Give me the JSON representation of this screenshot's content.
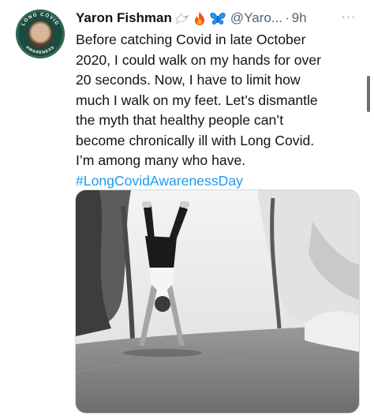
{
  "tweet": {
    "author_name": "Yaron Fishman",
    "author_emojis": [
      "dove-icon",
      "fire-icon",
      "butterfly-icon"
    ],
    "handle": "@Yaro...",
    "separator": "·",
    "time": "9h",
    "more": "···",
    "avatar": {
      "ring_top_text": "LONG COVID",
      "ring_bottom_text": "AWARENESS"
    },
    "text_lines": [
      "Before catching Covid in late October",
      "2020, I could walk on my hands for over",
      "20 seconds. Now, I have to limit how",
      "much I walk on my feet. Let’s dismantle",
      "the myth that healthy people can’t",
      "become chronically ill with Long Covid.",
      "I’m among many who have."
    ],
    "hashtag": "#LongCovidAwarenessDay",
    "media": {
      "kind": "photo",
      "subject": "person-handstand-icon"
    }
  },
  "colors": {
    "text": "#0f1419",
    "secondary": "#536471",
    "link": "#1d9bf0",
    "avatar_bg": "#1d4a3e"
  }
}
